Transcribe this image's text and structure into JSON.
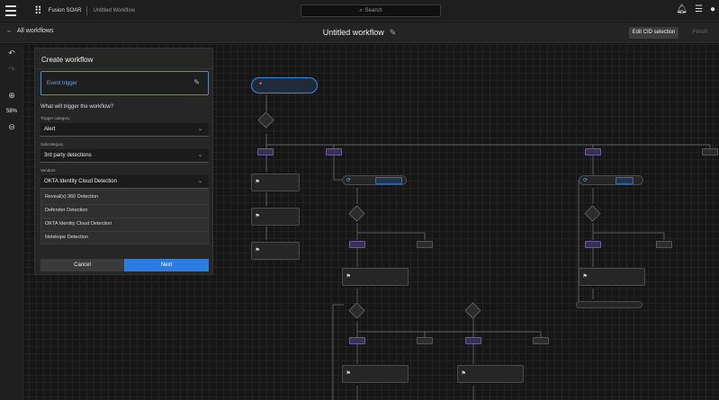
{
  "topbar": {
    "app_title": "Fusion SOAR",
    "doc_title": "Untitled Workflow",
    "search_placeholder": "Search"
  },
  "subbar": {
    "back_label": "All workflows",
    "workflow_title": "Untitled workflow",
    "edit_cid_label": "Edit CID selection",
    "finish_label": "Finish"
  },
  "toolbar": {
    "zoom_level": "58%"
  },
  "panel": {
    "title": "Create workflow",
    "trigger_label": "Event trigger",
    "question": "What will trigger the workflow?",
    "trigger_category_label": "Trigger category",
    "trigger_category_value": "Alert",
    "subcategory_label": "Subcategory",
    "subcategory_value": "3rd party detections",
    "vendors_label": "Vendors",
    "vendors_value": "OKTA Identity Cloud Detection",
    "vendor_options": [
      "Reveal(x) 360 Detection",
      "Defender Detection",
      "OKTA Identity Cloud Detection",
      "Netskope Detection"
    ],
    "cancel_label": "Cancel",
    "next_label": "Next"
  },
  "colors": {
    "accent": "#2d7de0",
    "pill": "#3a2f55",
    "background": "#161616"
  },
  "icons": [
    "menu-icon",
    "falcon-logo-icon",
    "search-icon",
    "bell-icon",
    "help-icon",
    "user-icon",
    "back-arrow-icon",
    "undo-icon",
    "redo-icon",
    "zoom-in-icon",
    "zoom-out-icon",
    "pencil-icon",
    "chevron-down-icon",
    "flag-icon",
    "loop-icon"
  ]
}
